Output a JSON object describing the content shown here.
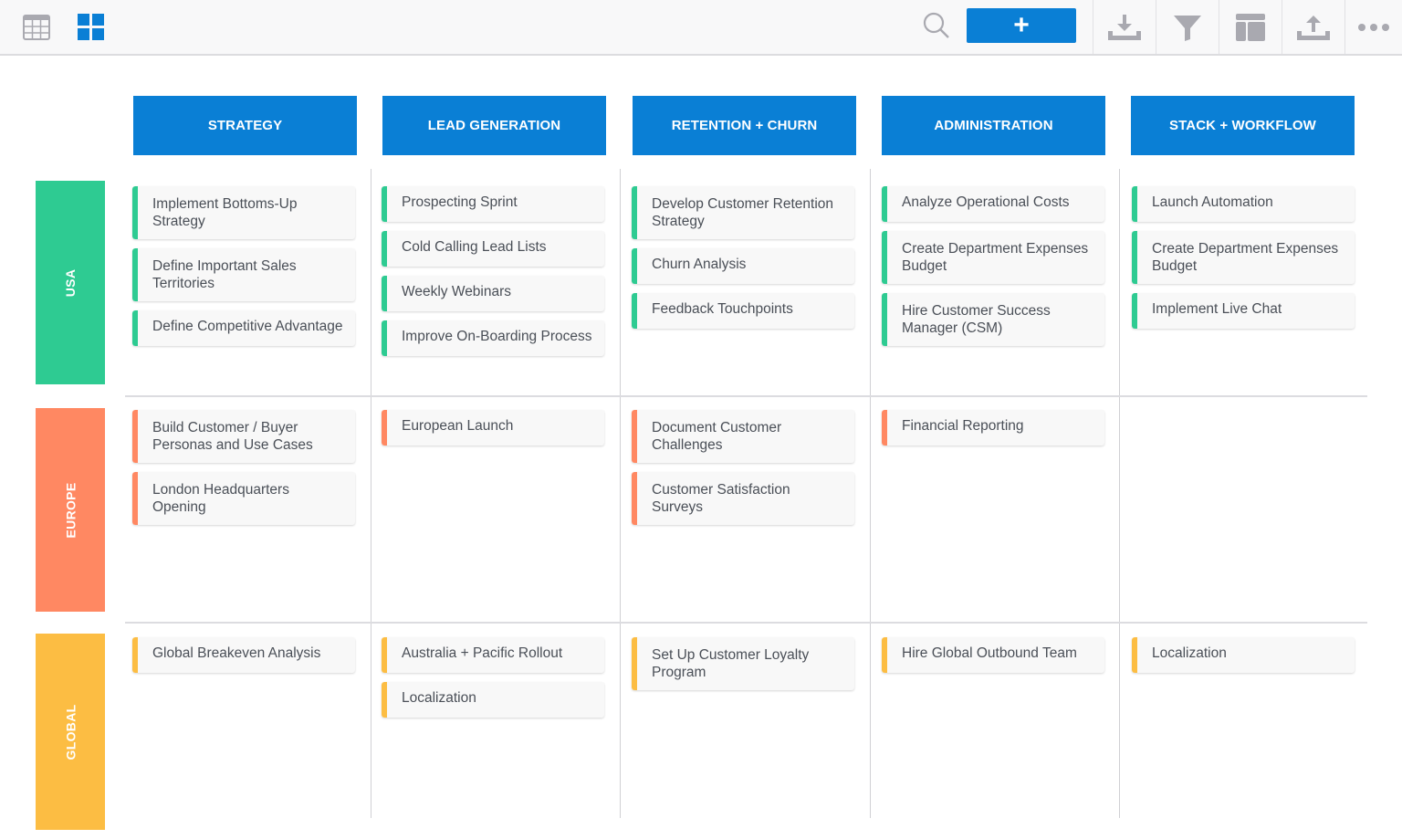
{
  "toolbar": {
    "left_icons": [
      {
        "name": "table-view-icon",
        "active": false
      },
      {
        "name": "board-view-icon",
        "active": true
      }
    ],
    "search_icon": "search-icon",
    "add_button_label": "+",
    "right_buttons": [
      {
        "name": "download-icon"
      },
      {
        "name": "filter-icon"
      },
      {
        "name": "layout-icon"
      },
      {
        "name": "upload-icon"
      },
      {
        "name": "more-icon",
        "label": "•••"
      }
    ]
  },
  "colors": {
    "brand": "#0a7fd5",
    "usa": "#2ecb92",
    "europe": "#ff8862",
    "global": "#fcbd43"
  },
  "columns": [
    {
      "label": "STRATEGY"
    },
    {
      "label": "LEAD GENERATION"
    },
    {
      "label": "RETENTION + CHURN"
    },
    {
      "label": "ADMINISTRATION"
    },
    {
      "label": "STACK + WORKFLOW"
    }
  ],
  "rows": [
    {
      "label": "USA",
      "color": "#2ecb92",
      "cells": [
        [
          {
            "text": "Implement Bottoms-Up Strategy"
          },
          {
            "text": "Define Important Sales Territories"
          },
          {
            "text": "Define Competitive Advantage"
          }
        ],
        [
          {
            "text": "Prospecting Sprint"
          },
          {
            "text": "Cold Calling Lead Lists"
          },
          {
            "text": "Weekly Webinars"
          },
          {
            "text": "Improve On-Boarding Process"
          }
        ],
        [
          {
            "text": "Develop Customer Retention Strategy"
          },
          {
            "text": "Churn Analysis"
          },
          {
            "text": "Feedback Touchpoints"
          }
        ],
        [
          {
            "text": "Analyze Operational Costs"
          },
          {
            "text": "Create Department Expenses Budget"
          },
          {
            "text": "Hire Customer Success Manager (CSM)"
          }
        ],
        [
          {
            "text": "Launch Automation"
          },
          {
            "text": "Create Department Expenses Budget"
          },
          {
            "text": "Implement Live Chat"
          }
        ]
      ]
    },
    {
      "label": "EUROPE",
      "color": "#ff8862",
      "cells": [
        [
          {
            "text": "Build Customer / Buyer Personas and Use Cases"
          },
          {
            "text": "London Headquarters Opening"
          }
        ],
        [
          {
            "text": "European Launch"
          }
        ],
        [
          {
            "text": "Document Customer Challenges"
          },
          {
            "text": "Customer Satisfaction Surveys"
          }
        ],
        [
          {
            "text": "Financial Reporting"
          }
        ],
        []
      ]
    },
    {
      "label": "GLOBAL",
      "color": "#fcbd43",
      "cells": [
        [
          {
            "text": "Global Breakeven Analysis"
          }
        ],
        [
          {
            "text": "Australia + Pacific Rollout"
          },
          {
            "text": "Localization"
          }
        ],
        [
          {
            "text": "Set Up Customer Loyalty Program"
          }
        ],
        [
          {
            "text": "Hire Global Outbound Team"
          }
        ],
        [
          {
            "text": "Localization"
          }
        ]
      ]
    }
  ]
}
